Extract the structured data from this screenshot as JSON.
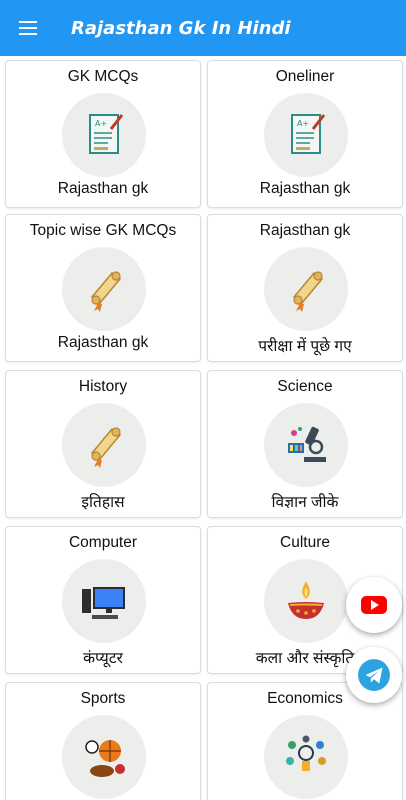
{
  "app_title": "Rajasthan Gk In Hindi",
  "colors": {
    "appbar": "#2196f3",
    "youtube": "#ff0000",
    "telegram": "#2aa3de"
  },
  "cards": [
    {
      "title": "GK MCQs",
      "subtitle": "Rajasthan gk",
      "icon": "exam-paper-icon"
    },
    {
      "title": "Oneliner",
      "subtitle": "Rajasthan gk",
      "icon": "exam-paper-icon"
    },
    {
      "title": "Topic wise GK MCQs",
      "subtitle": "Rajasthan gk",
      "icon": "scroll-icon"
    },
    {
      "title": "Rajasthan gk",
      "subtitle": "परीक्षा में पूछे गए",
      "icon": "scroll-icon"
    },
    {
      "title": "History",
      "subtitle": "इतिहास",
      "icon": "scroll-icon"
    },
    {
      "title": "Science",
      "subtitle": "विज्ञान जीके",
      "icon": "microscope-icon"
    },
    {
      "title": "Computer",
      "subtitle": "कंप्यूटर",
      "icon": "computer-icon"
    },
    {
      "title": "Culture",
      "subtitle": "कला और संस्कृति",
      "icon": "diya-lamp-icon"
    },
    {
      "title": "Sports",
      "subtitle": "",
      "icon": "sports-balls-icon"
    },
    {
      "title": "Economics",
      "subtitle": "",
      "icon": "economics-icon"
    }
  ]
}
